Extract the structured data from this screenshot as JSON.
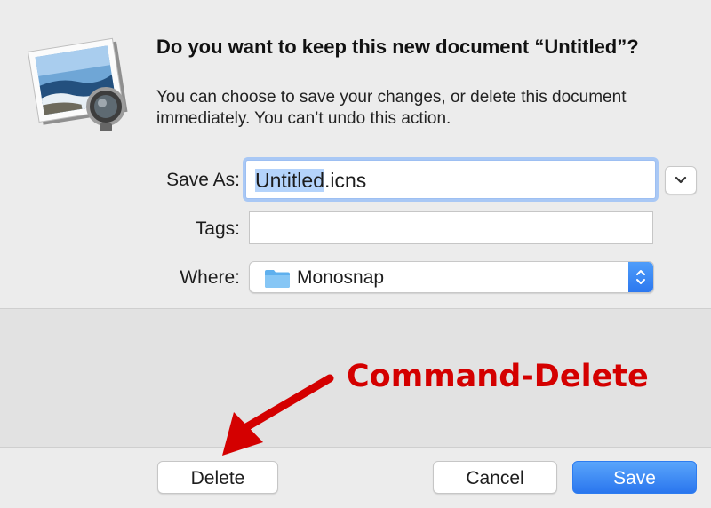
{
  "dialog": {
    "title": "Do you want to keep this new document “Untitled”?",
    "message": "You can choose to save your changes, or delete this document immediately. You can’t undo this action."
  },
  "form": {
    "save_as_label": "Save As:",
    "save_as_selected": "Untitled",
    "save_as_rest": ".icns",
    "tags_label": "Tags:",
    "tags_value": "",
    "where_label": "Where:",
    "where_value": "Monosnap"
  },
  "icons": {
    "app": "preview-app-icon",
    "expand": "chevron-down-icon",
    "folder": "folder-icon",
    "popup": "up-down-arrows-icon"
  },
  "annotation": {
    "text": "Command-Delete",
    "color": "#d40000"
  },
  "buttons": {
    "delete": "Delete",
    "cancel": "Cancel",
    "save": "Save"
  },
  "colors": {
    "accent": "#2d78ef",
    "background": "#ececec"
  }
}
